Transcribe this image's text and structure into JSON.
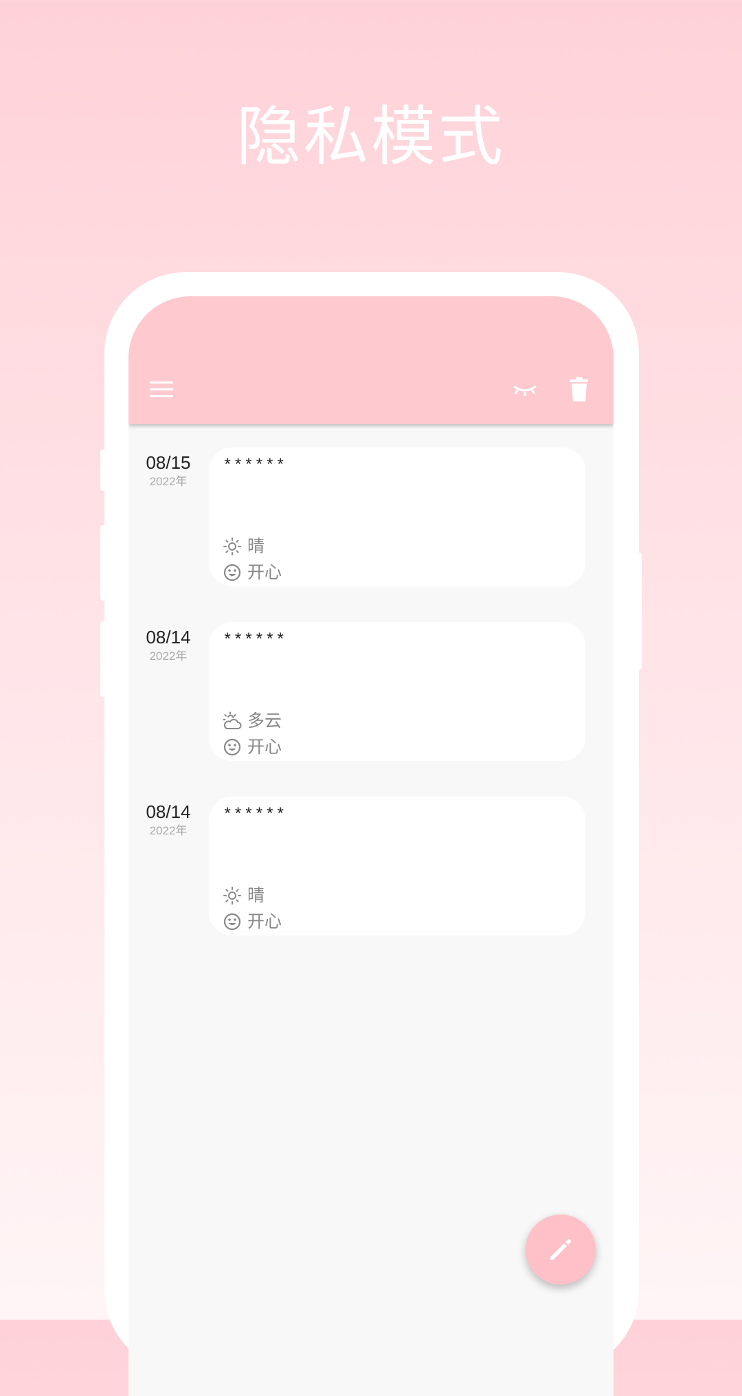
{
  "promo": {
    "title": "隐私模式"
  },
  "app_bar": {
    "icons": [
      "menu-icon",
      "eye-closed-icon",
      "trash-icon"
    ]
  },
  "entries": [
    {
      "date": "08/15",
      "year": "2022年",
      "text": "******",
      "weather_icon": "sun-icon",
      "weather": "晴",
      "mood_icon": "smile-icon",
      "mood": "开心"
    },
    {
      "date": "08/14",
      "year": "2022年",
      "text": "******",
      "weather_icon": "partly-cloudy-icon",
      "weather": "多云",
      "mood_icon": "smile-icon",
      "mood": "开心"
    },
    {
      "date": "08/14",
      "year": "2022年",
      "text": "******",
      "weather_icon": "sun-icon",
      "weather": "晴",
      "mood_icon": "smile-icon",
      "mood": "开心"
    }
  ],
  "fab": {
    "icon": "pencil-icon"
  },
  "colors": {
    "app_bar": "#ffcacf",
    "fab": "#ffc0c8",
    "screen_bg": "#f8f8f8",
    "muted_text": "#888888"
  }
}
